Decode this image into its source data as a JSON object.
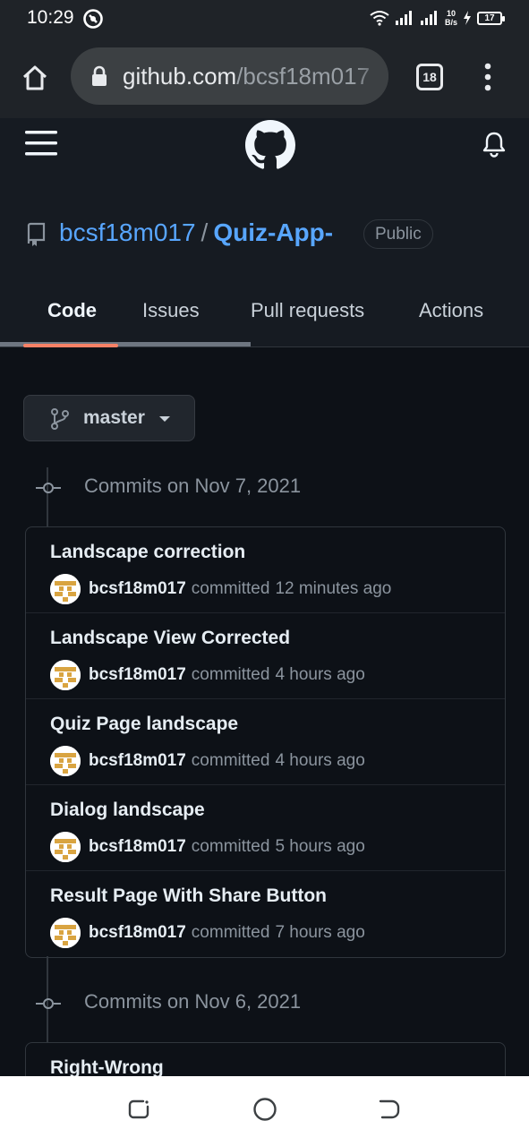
{
  "status_bar": {
    "time": "10:29",
    "net_speed_value": "10",
    "net_speed_unit": "B/s",
    "battery": "17"
  },
  "browser": {
    "url_host": "github.com",
    "url_path": "/bcsf18m017",
    "tab_count": "18"
  },
  "repo": {
    "owner": "bcsf18m017",
    "separator": "/",
    "name": "Quiz-App-",
    "visibility": "Public"
  },
  "tabs": [
    {
      "label": "Code",
      "active": true
    },
    {
      "label": "Issues",
      "active": false
    },
    {
      "label": "Pull requests",
      "active": false
    },
    {
      "label": "Actions",
      "active": false
    }
  ],
  "branch": {
    "label": "master"
  },
  "commit_groups": [
    {
      "date_label": "Commits on Nov 7, 2021",
      "commits": [
        {
          "title": "Landscape correction",
          "author": "bcsf18m017",
          "verb": "committed",
          "ago": "12 minutes ago"
        },
        {
          "title": "Landscape View Corrected",
          "author": "bcsf18m017",
          "verb": "committed",
          "ago": "4 hours ago"
        },
        {
          "title": "Quiz Page landscape",
          "author": "bcsf18m017",
          "verb": "committed",
          "ago": "4 hours ago"
        },
        {
          "title": "Dialog landscape",
          "author": "bcsf18m017",
          "verb": "committed",
          "ago": "5 hours ago"
        },
        {
          "title": "Result Page With Share Button",
          "author": "bcsf18m017",
          "verb": "committed",
          "ago": "7 hours ago"
        }
      ]
    },
    {
      "date_label": "Commits on Nov 6, 2021",
      "commits": [
        {
          "title": "Right-Wrong"
        }
      ]
    }
  ],
  "colors": {
    "background": "#0d1117",
    "header": "#161b22",
    "link": "#58a6ff",
    "tab_underline": "#f78166",
    "avatar_pattern": "#d9a441"
  },
  "icons": [
    "dnd-icon",
    "wifi-icon",
    "signal-icon",
    "charging-icon",
    "home-icon",
    "lock-icon",
    "more-vert-icon",
    "hamburger-icon",
    "github-logo-icon",
    "bell-icon",
    "repo-icon",
    "branch-icon",
    "commit-dot-icon",
    "recents-icon",
    "home-circle-icon",
    "back-icon"
  ]
}
